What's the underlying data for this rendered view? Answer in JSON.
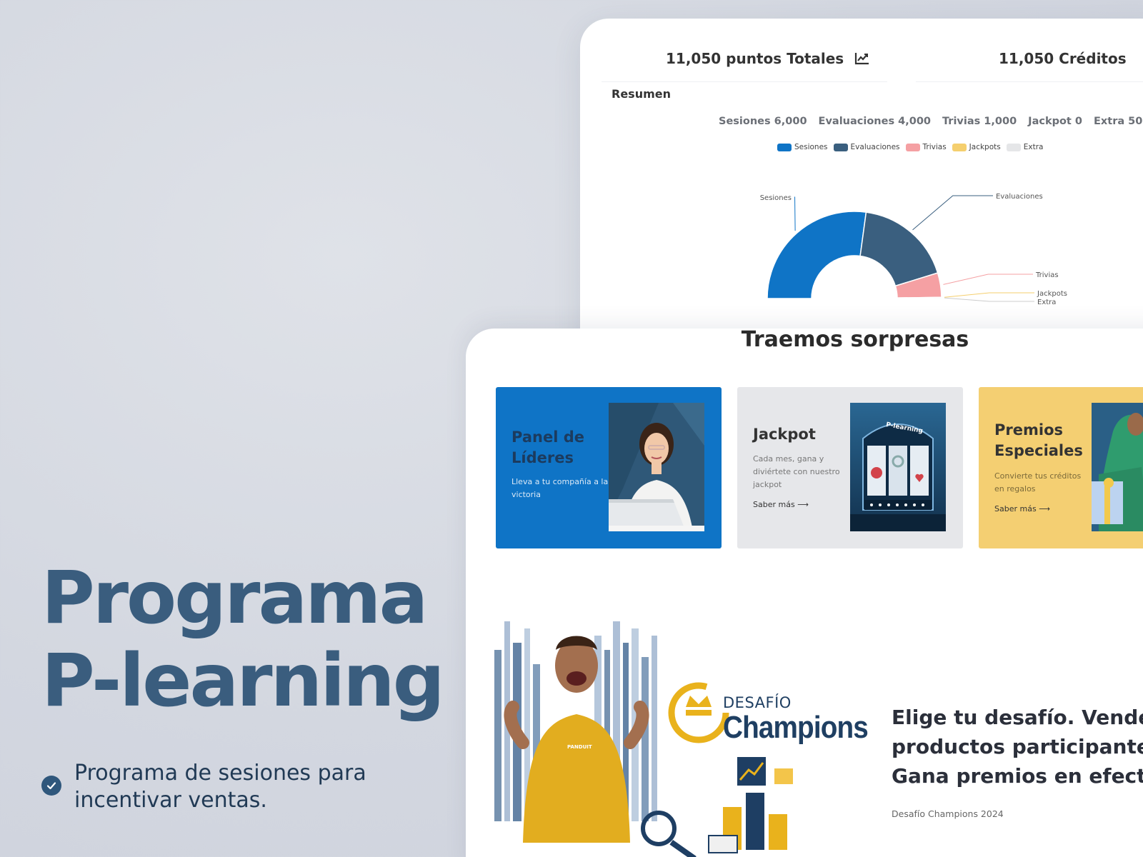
{
  "hero": {
    "title_line1": "Programa",
    "title_line2": "P-learning",
    "bullet": "Programa de sesiones para incentivar ventas."
  },
  "dashboard": {
    "points_total": "11,050 puntos Totales",
    "credits_total": "11,050 Créditos",
    "summary_title": "Resumen",
    "totals": [
      {
        "label": "Sesiones 6,000"
      },
      {
        "label": "Evaluaciones 4,000"
      },
      {
        "label": "Trivias 1,000"
      },
      {
        "label": "Jackpot 0"
      },
      {
        "label": "Extra 50"
      }
    ],
    "chart_data": {
      "type": "pie",
      "style": "half-donut",
      "categories": [
        "Sesiones",
        "Evaluaciones",
        "Trivias",
        "Jackpots",
        "Extra"
      ],
      "values": [
        6000,
        4000,
        1000,
        0,
        50
      ],
      "colors": [
        "#0f74c6",
        "#3a5f7f",
        "#f5a0a3",
        "#f5cf6e",
        "#e5e6e8"
      ],
      "legend": "top",
      "slice_labels": [
        "Sesiones",
        "Evaluaciones",
        "Trivias",
        "Jackpots",
        "Extra"
      ]
    }
  },
  "section": {
    "title": "Traemos sorpresas"
  },
  "promos": [
    {
      "title": "Panel de Líderes",
      "desc": "Lleva a tu compañía a la victoria",
      "link": "",
      "bg": "#0f74c6"
    },
    {
      "title": "Jackpot",
      "desc": "Cada mes, gana y diviértete con nuestro jackpot",
      "link": "Saber más",
      "bg": "#e6e7ea"
    },
    {
      "title": "Premios Especiales",
      "desc": "Convierte tus créditos en regalos",
      "link": "Saber más",
      "bg": "#f4cf72"
    }
  ],
  "jackpot_brand": "P-learning",
  "champions": {
    "logo_small": "DESAFÍO",
    "logo_big": "Champions",
    "shirt_brand": "PANDUIT",
    "headline_line1": "Elige tu desafío. Vende",
    "headline_line2": "productos participantes.",
    "headline_line3": "Gana premios en efectivo.",
    "caption": "Desafío Champions 2024"
  }
}
